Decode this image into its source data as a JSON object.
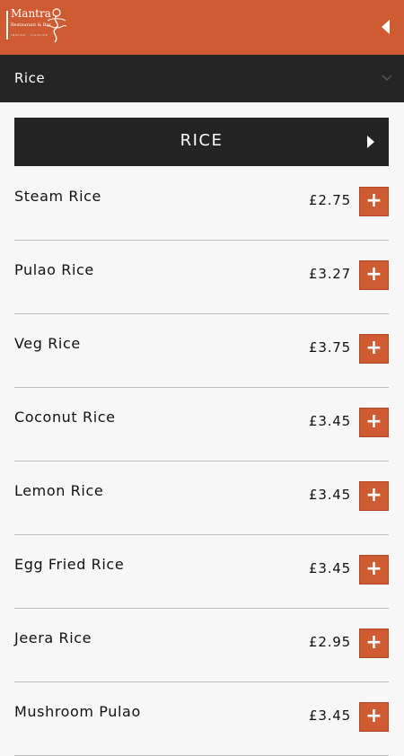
{
  "header": {
    "logo": {
      "name": "Mantra",
      "tagline": "Restaurant & Bar",
      "subline": "INDIAN · CUISINE"
    },
    "back_icon": "triangle-left-icon",
    "accent_color": "#cf5b33"
  },
  "category_selector": {
    "selected": "Rice",
    "icon": "chevron-down-icon"
  },
  "section": {
    "title": "RICE",
    "icon": "caret-right-icon"
  },
  "menu_items": [
    {
      "name": "Steam Rice",
      "price": "£2.75",
      "add_label": "+"
    },
    {
      "name": "Pulao Rice",
      "price": "£3.27",
      "add_label": "+"
    },
    {
      "name": "Veg Rice",
      "price": "£3.75",
      "add_label": "+"
    },
    {
      "name": "Coconut Rice",
      "price": "£3.45",
      "add_label": "+"
    },
    {
      "name": "Lemon Rice",
      "price": "£3.45",
      "add_label": "+"
    },
    {
      "name": "Egg Fried Rice",
      "price": "£3.45",
      "add_label": "+"
    },
    {
      "name": "Jeera Rice",
      "price": "£2.95",
      "add_label": "+"
    },
    {
      "name": "Mushroom Pulao",
      "price": "£3.45",
      "add_label": "+"
    }
  ]
}
